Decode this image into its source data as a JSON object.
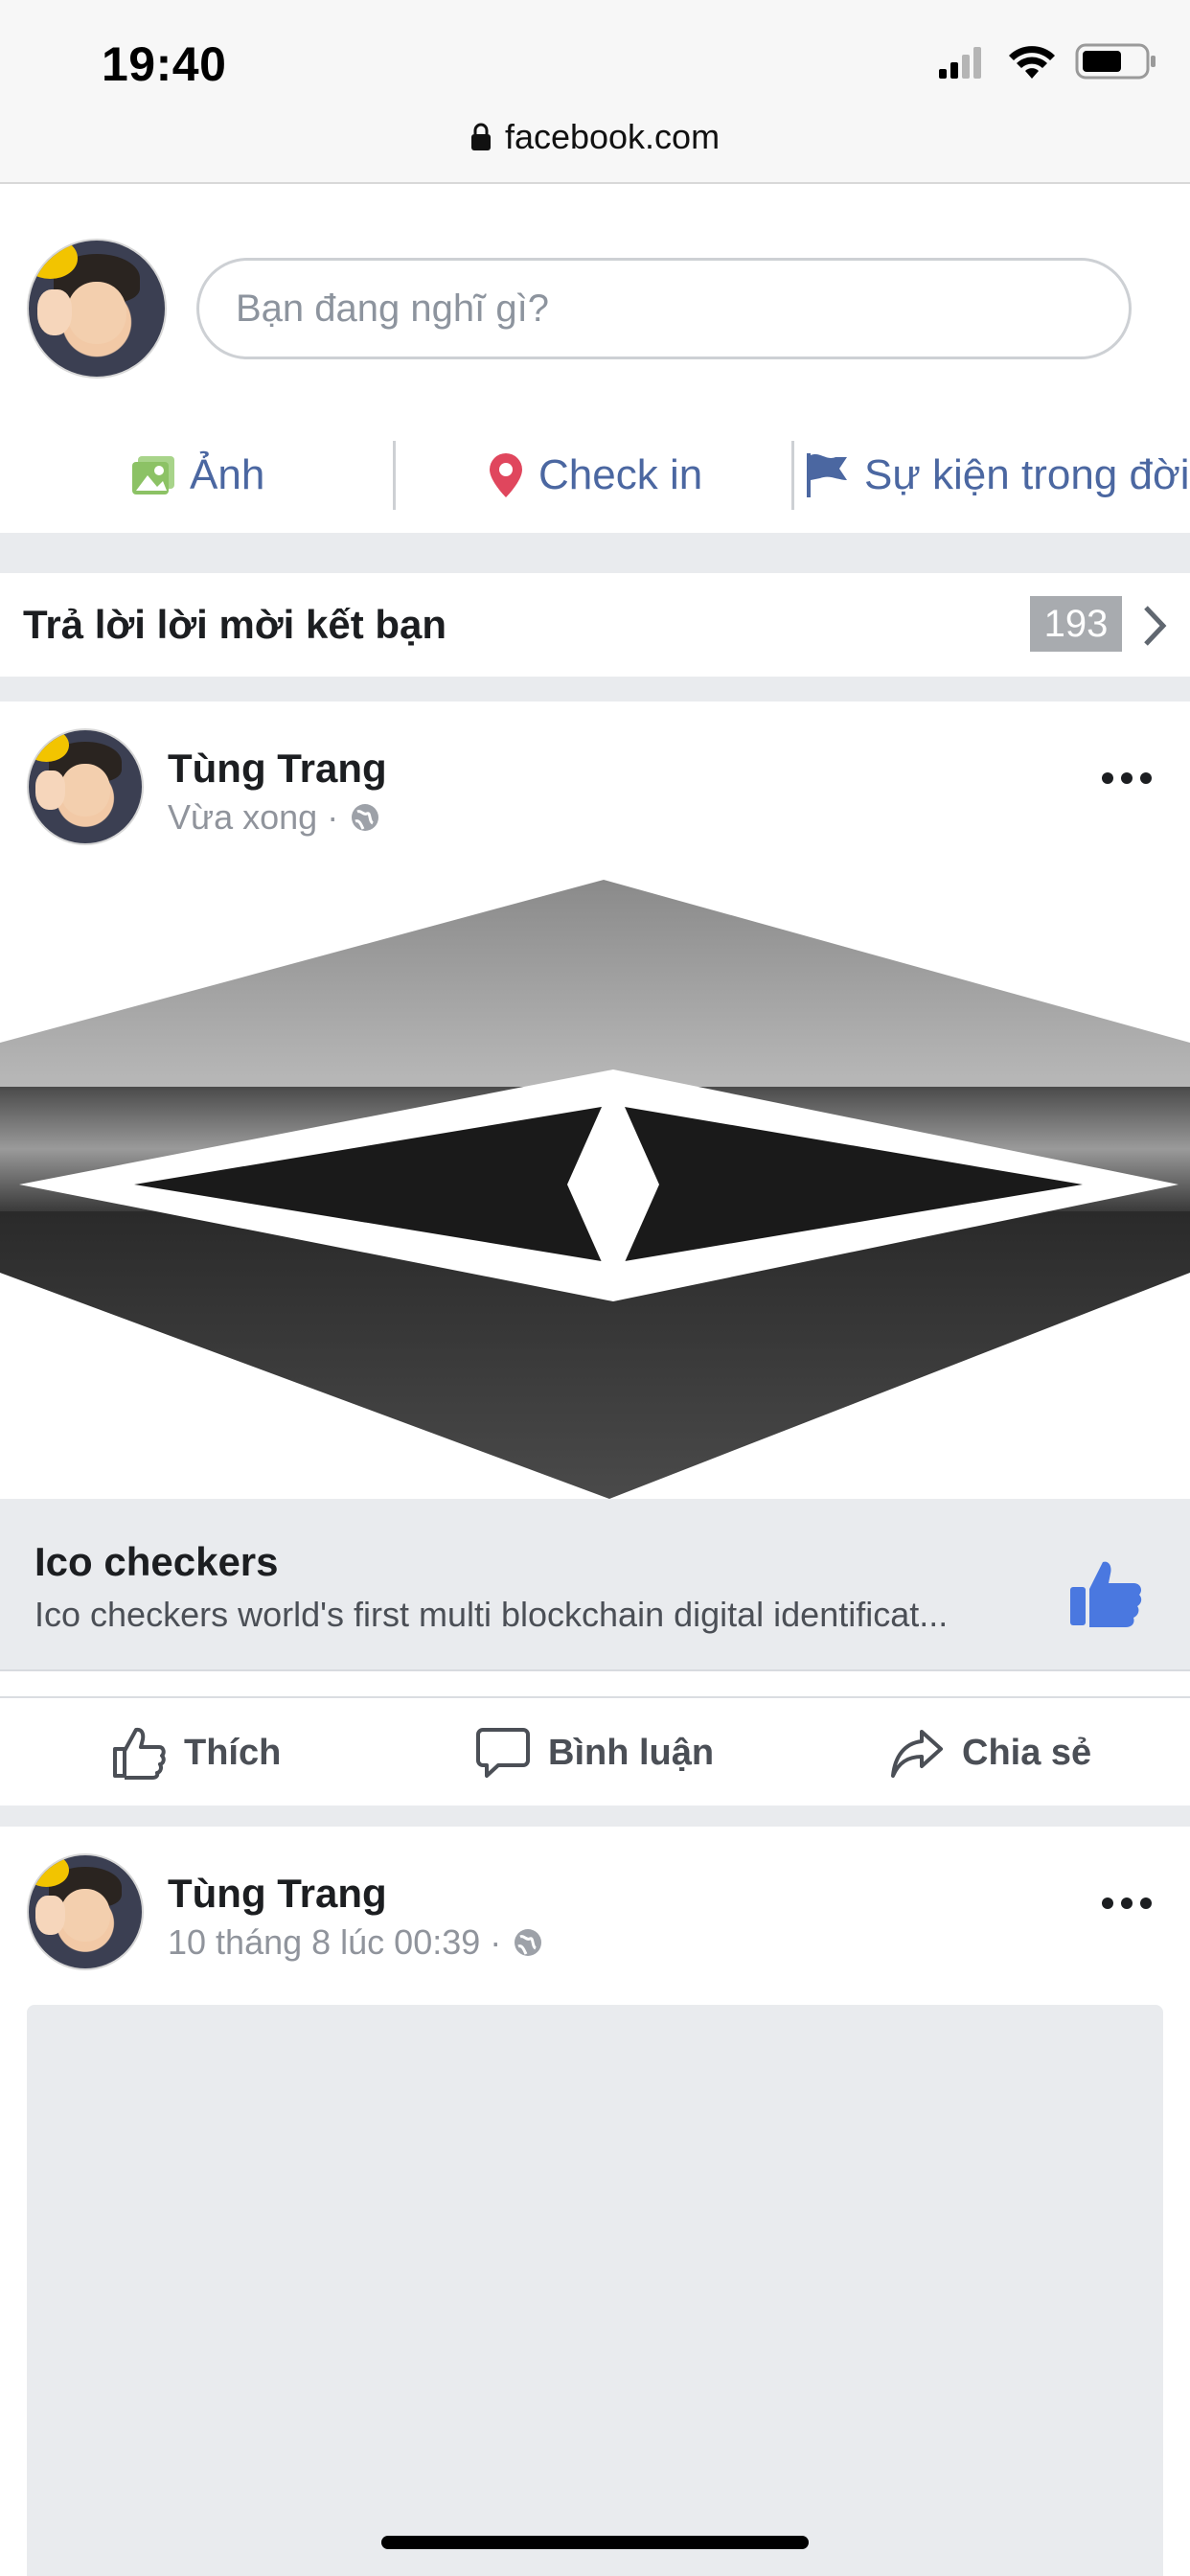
{
  "status_bar": {
    "time": "19:40",
    "icons": [
      "cellular-signal-icon",
      "wifi-icon",
      "battery-icon"
    ]
  },
  "browser": {
    "url": "facebook.com",
    "lock_icon": "lock-icon"
  },
  "composer": {
    "placeholder": "Bạn đang nghĩ gì?",
    "actions": [
      {
        "label": "Ảnh",
        "icon": "photo-icon",
        "color": "#8cc265"
      },
      {
        "label": "Check in",
        "icon": "location-pin-icon",
        "color": "#e0465d"
      },
      {
        "label": "Sự kiện trong đời",
        "icon": "flag-icon",
        "color": "#4b67a1"
      }
    ]
  },
  "friend_requests": {
    "label": "Trả lời lời mời kết bạn",
    "count": "193"
  },
  "posts": [
    {
      "author": "Tùng Trang",
      "meta": "Vừa xong ·",
      "privacy_icon": "globe-icon",
      "link": {
        "title": "Ico checkers",
        "description": "Ico checkers world's first multi blockchain digital identificat..."
      },
      "actions": [
        {
          "label": "Thích",
          "icon": "like-icon"
        },
        {
          "label": "Bình luận",
          "icon": "comment-icon"
        },
        {
          "label": "Chia sẻ",
          "icon": "share-icon"
        }
      ]
    },
    {
      "author": "Tùng Trang",
      "meta": "10 tháng 8 lúc 00:39 ·",
      "privacy_icon": "globe-icon"
    }
  ],
  "colors": {
    "facebook_blue": "#4b67a1",
    "like_blue": "#4a78e0",
    "feed_gray": "#e9ebee",
    "meta_gray": "#90949c"
  }
}
